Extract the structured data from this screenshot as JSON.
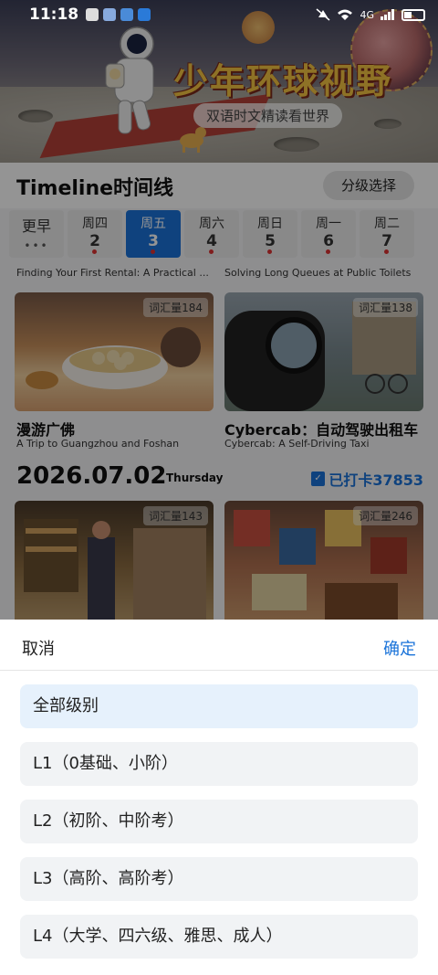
{
  "status_bar": {
    "time": "11:18",
    "network": "4G",
    "icons": [
      "notification-icon",
      "wechat-icon",
      "app-icon",
      "cloud-icon",
      "mute-icon",
      "wifi-icon",
      "signal-icon",
      "battery-icon"
    ]
  },
  "banner": {
    "title": "少年环球视野",
    "subtitle": "双语时文精读看世界"
  },
  "timeline": {
    "title": "Timeline时间线",
    "level_button": "分级选择",
    "days": [
      {
        "name": "更早",
        "num": "•••"
      },
      {
        "name": "周四",
        "num": "2"
      },
      {
        "name": "周五",
        "num": "3"
      },
      {
        "name": "周六",
        "num": "4"
      },
      {
        "name": "周日",
        "num": "5"
      },
      {
        "name": "周一",
        "num": "6"
      },
      {
        "name": "周二",
        "num": "7"
      }
    ],
    "active_day": "周五"
  },
  "articles_top": {
    "cut_left": "Finding Your First Rental: A Practical ...",
    "cut_right": "Solving Long Queues at Public Toilets"
  },
  "cards": [
    {
      "vocab": "词汇量184",
      "title": "漫游广佛",
      "subtitle": "A Trip to Guangzhou and Foshan"
    },
    {
      "vocab": "词汇量138",
      "title": "Cybercab：自动驾驶出租车",
      "subtitle": "Cybercab: A Self-Driving Taxi"
    },
    {
      "vocab": "词汇量143"
    },
    {
      "vocab": "词汇量246"
    }
  ],
  "date_row": {
    "date": "2026.07.02",
    "weekday": "Thursday",
    "checkin": "已打卡37853"
  },
  "sheet": {
    "cancel": "取消",
    "confirm": "确定",
    "options": [
      "全部级别",
      "L1（0基础、小阶）",
      "L2（初阶、中阶考）",
      "L3（高阶、高阶考）",
      "L4（大学、四六级、雅思、成人）"
    ],
    "selected_index": 0
  },
  "colors": {
    "accent": "#1a73d9",
    "dot": "#dd3333",
    "selected_option": "#e6f1fc"
  }
}
